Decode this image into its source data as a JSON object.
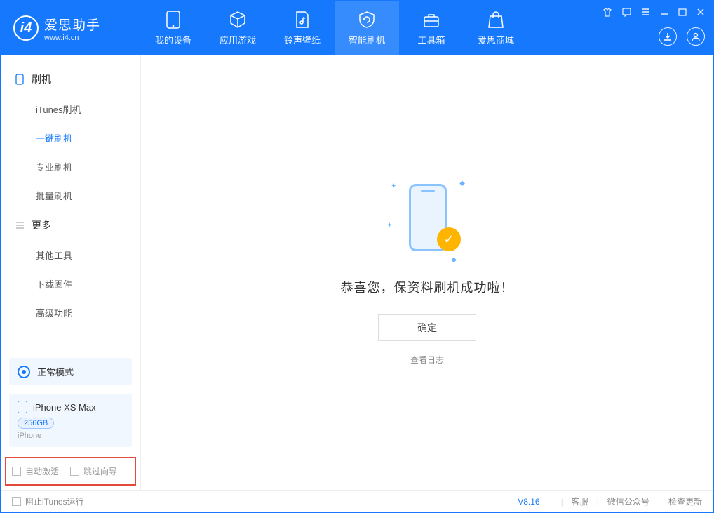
{
  "app": {
    "name_cn": "爱思助手",
    "name_en": "www.i4.cn"
  },
  "tabs": [
    {
      "label": "我的设备"
    },
    {
      "label": "应用游戏"
    },
    {
      "label": "铃声壁纸"
    },
    {
      "label": "智能刷机"
    },
    {
      "label": "工具箱"
    },
    {
      "label": "爱思商城"
    }
  ],
  "sidebar": {
    "group1_title": "刷机",
    "group1_items": [
      {
        "label": "iTunes刷机"
      },
      {
        "label": "一键刷机"
      },
      {
        "label": "专业刷机"
      },
      {
        "label": "批量刷机"
      }
    ],
    "group2_title": "更多",
    "group2_items": [
      {
        "label": "其他工具"
      },
      {
        "label": "下载固件"
      },
      {
        "label": "高级功能"
      }
    ],
    "mode_label": "正常模式",
    "device_name": "iPhone XS Max",
    "device_capacity": "256GB",
    "device_type": "iPhone",
    "opt_auto_activate": "自动激活",
    "opt_skip_guide": "跳过向导"
  },
  "main": {
    "success_msg": "恭喜您，保资料刷机成功啦！",
    "ok_btn": "确定",
    "view_log": "查看日志"
  },
  "footer": {
    "block_itunes": "阻止iTunes运行",
    "version": "V8.16",
    "link_service": "客服",
    "link_wechat": "微信公众号",
    "link_update": "检查更新"
  }
}
